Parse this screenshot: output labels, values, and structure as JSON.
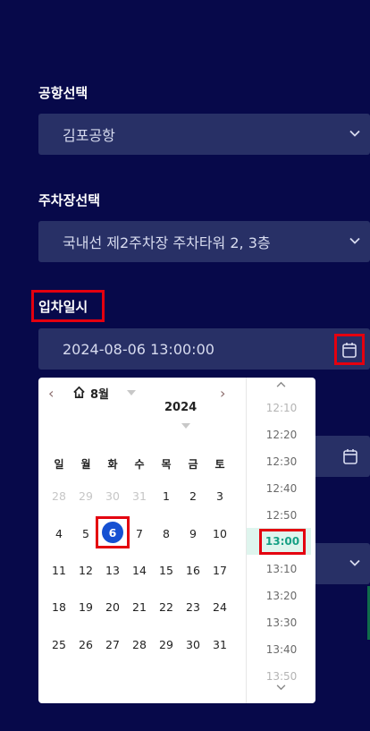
{
  "airport": {
    "label": "공항선택",
    "value": "김포공항"
  },
  "parking": {
    "label": "주차장선택",
    "value": "국내선 제2주차장 주차타워 2, 3층"
  },
  "entry": {
    "label": "입차일시",
    "value": "2024-08-06 13:00:00"
  },
  "calendar": {
    "month_label": "8월",
    "year_label": "2024",
    "weekdays": [
      "일",
      "월",
      "화",
      "수",
      "목",
      "금",
      "토"
    ],
    "weeks": [
      [
        "28",
        "29",
        "30",
        "31",
        "1",
        "2",
        "3"
      ],
      [
        "4",
        "5",
        "6",
        "7",
        "8",
        "9",
        "10"
      ],
      [
        "11",
        "12",
        "13",
        "14",
        "15",
        "16",
        "17"
      ],
      [
        "18",
        "19",
        "20",
        "21",
        "22",
        "23",
        "24"
      ],
      [
        "25",
        "26",
        "27",
        "28",
        "29",
        "30",
        "31"
      ]
    ],
    "selected_day": "6"
  },
  "time_list": {
    "items": [
      "12:10",
      "12:20",
      "12:30",
      "12:40",
      "12:50",
      "13:00",
      "13:10",
      "13:20",
      "13:30",
      "13:40",
      "13:50"
    ],
    "selected": "13:00"
  },
  "colors": {
    "background": "#07094a",
    "field": "#283066",
    "highlight": "#e4000f",
    "selected_day": "#1550d2",
    "selected_time": "#16a085"
  }
}
